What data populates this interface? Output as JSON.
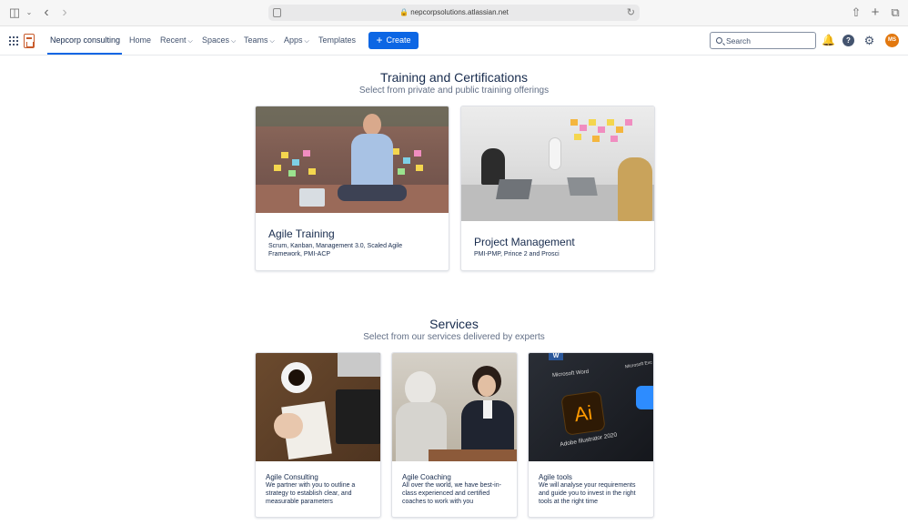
{
  "browser": {
    "url": "nepcorpsolutions.atlassian.net"
  },
  "nav": {
    "site": "Nepcorp consulting",
    "home": "Home",
    "recent": "Recent",
    "spaces": "Spaces",
    "teams": "Teams",
    "apps": "Apps",
    "templates": "Templates",
    "create": "Create",
    "search_placeholder": "Search",
    "avatar_initials": "MS"
  },
  "training": {
    "title": "Training and Certifications",
    "subtitle": "Select from private and public training offerings",
    "cards": [
      {
        "title": "Agile Training",
        "description": "Scrum, Kanban, Management 3.0, Scaled Agile Framework, PMI-ACP"
      },
      {
        "title": "Project Management",
        "description": "PMI-PMP, Prince 2 and Prosci"
      }
    ]
  },
  "services": {
    "title": "Services",
    "subtitle": "Select from our services delivered by experts",
    "cards": [
      {
        "title": "Agile Consulting",
        "description": "We partner with you to outline a strategy to establish clear, and measurable parameters"
      },
      {
        "title": "Agile Coaching",
        "description": "All over the world, we have best-in-class experienced and certified coaches to work with you"
      },
      {
        "title": "Agile tools",
        "description": "We will analyse your requirements and guide you to invest in the right tools at the right time"
      }
    ]
  },
  "tools_image": {
    "word_label": "Microsoft Word",
    "excel_label": "Microsoft Exc",
    "ai_glyph": "Ai",
    "illustrator_label": "Adobe Illustrator 2020"
  },
  "colors": {
    "primary": "#0c66e4",
    "text": "#172b4d",
    "subtext": "#626f86",
    "avatar": "#e2780f"
  }
}
